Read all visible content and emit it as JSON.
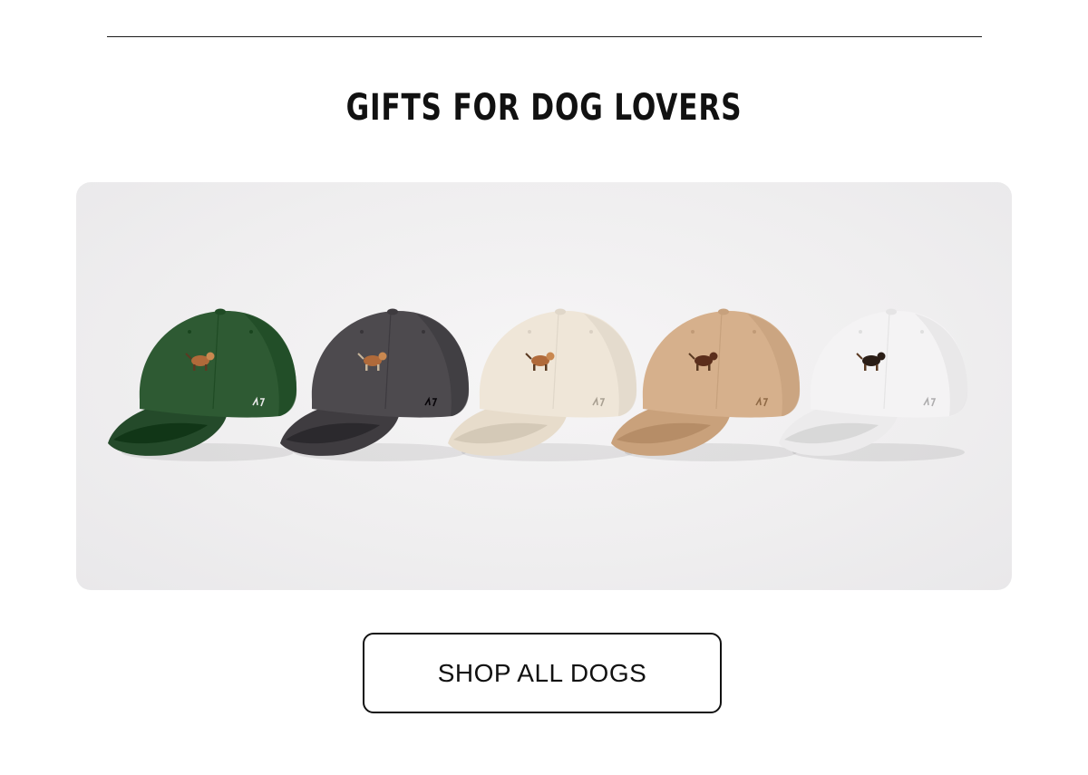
{
  "section": {
    "heading": "GIFTS FOR DOG LOVERS"
  },
  "hero": {
    "caps": [
      {
        "color_name": "green",
        "crown": "#2e5a33",
        "brim": "#244a2a",
        "dog": "beagle",
        "logo": "47"
      },
      {
        "color_name": "charcoal",
        "crown": "#4d4a4e",
        "brim": "#3f3c40",
        "dog": "french-bulldog",
        "logo": "47"
      },
      {
        "color_name": "cream",
        "crown": "#efe6d8",
        "brim": "#e7dccb",
        "dog": "bulldog",
        "logo": "47"
      },
      {
        "color_name": "tan",
        "crown": "#d6b08c",
        "brim": "#c9a17b",
        "dog": "labrador",
        "logo": "47"
      },
      {
        "color_name": "white",
        "crown": "#f4f3f4",
        "brim": "#ecebec",
        "dog": "dachshund",
        "logo": "47"
      }
    ]
  },
  "cta": {
    "label": "SHOP ALL DOGS"
  }
}
